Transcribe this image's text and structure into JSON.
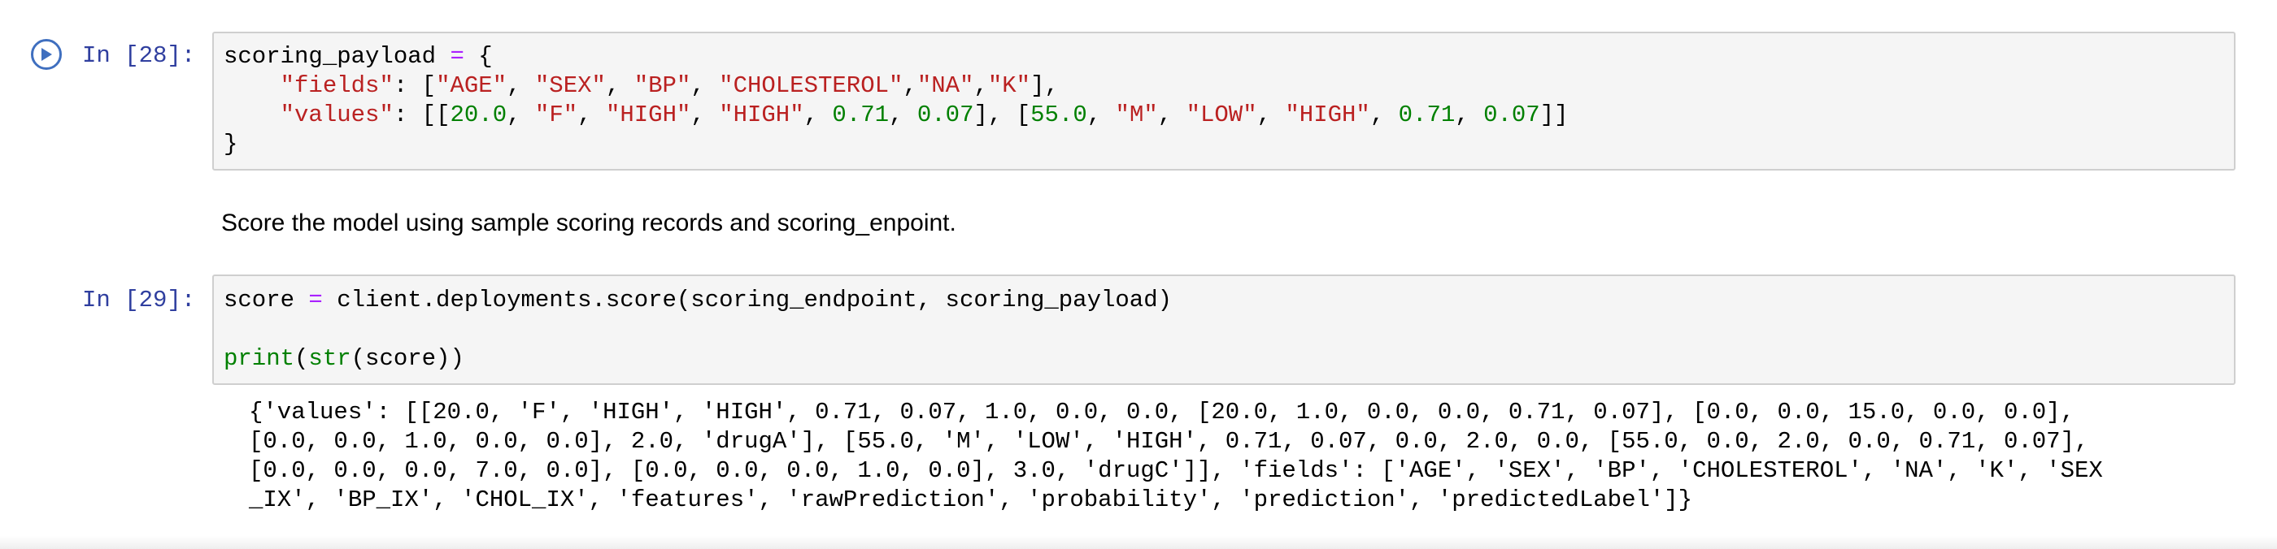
{
  "cell28": {
    "prompt": "In [28]:",
    "l1_var": "scoring_payload",
    "l1_eq": "=",
    "l1_brace": "{",
    "l2_indent": "    ",
    "l2_key": "\"fields\"",
    "l2_colon": ": [",
    "l2_f1": "\"AGE\"",
    "l2_f2": "\"SEX\"",
    "l2_f3": "\"BP\"",
    "l2_f4": "\"CHOLESTEROL\"",
    "l2_f5": "\"NA\"",
    "l2_f6": "\"K\"",
    "l3_indent": "    ",
    "l3_key": "\"values\"",
    "l3_colon": ": [[",
    "l3_a1": "20.0",
    "l3_a2": "\"F\"",
    "l3_a3": "\"HIGH\"",
    "l3_a4": "\"HIGH\"",
    "l3_a5": "0.71",
    "l3_a6": "0.07",
    "l3_b1": "55.0",
    "l3_b2": "\"M\"",
    "l3_b3": "\"LOW\"",
    "l3_b4": "\"HIGH\"",
    "l3_b5": "0.71",
    "l3_b6": "0.07",
    "l4_brace": "}"
  },
  "markdown": {
    "text": "Score the model using sample scoring records and scoring_enpoint."
  },
  "cell29": {
    "prompt": "In [29]:",
    "l1_var": "score",
    "l1_eq": "=",
    "l1_rest": "client.deployments.score(scoring_endpoint, scoring_payload)",
    "l2_print": "print",
    "l2_open": "(",
    "l2_str": "str",
    "l2_rest": "(score))"
  },
  "output29": {
    "lines": [
      "{'values': [[20.0, 'F', 'HIGH', 'HIGH', 0.71, 0.07, 1.0, 0.0, 0.0, [20.0, 1.0, 0.0, 0.0, 0.71, 0.07], [0.0, 0.0, 15.0, 0.0, 0.0],",
      "[0.0, 0.0, 1.0, 0.0, 0.0], 2.0, 'drugA'], [55.0, 'M', 'LOW', 'HIGH', 0.71, 0.07, 0.0, 2.0, 0.0, [55.0, 0.0, 2.0, 0.0, 0.71, 0.07],",
      "[0.0, 0.0, 0.0, 7.0, 0.0], [0.0, 0.0, 0.0, 1.0, 0.0], 3.0, 'drugC']], 'fields': ['AGE', 'SEX', 'BP', 'CHOLESTEROL', 'NA', 'K', 'SEX",
      "_IX', 'BP_IX', 'CHOL_IX', 'features', 'rawPrediction', 'probability', 'prediction', 'predictedLabel']}"
    ]
  },
  "colors": {
    "prompt": "#303f9f",
    "string": "#ba2121",
    "number": "#008000",
    "operator": "#aa22ff",
    "cell_bg": "#f5f5f5",
    "run_button": "#3f6fbf"
  },
  "icons": {
    "run": "run-cell-icon"
  }
}
